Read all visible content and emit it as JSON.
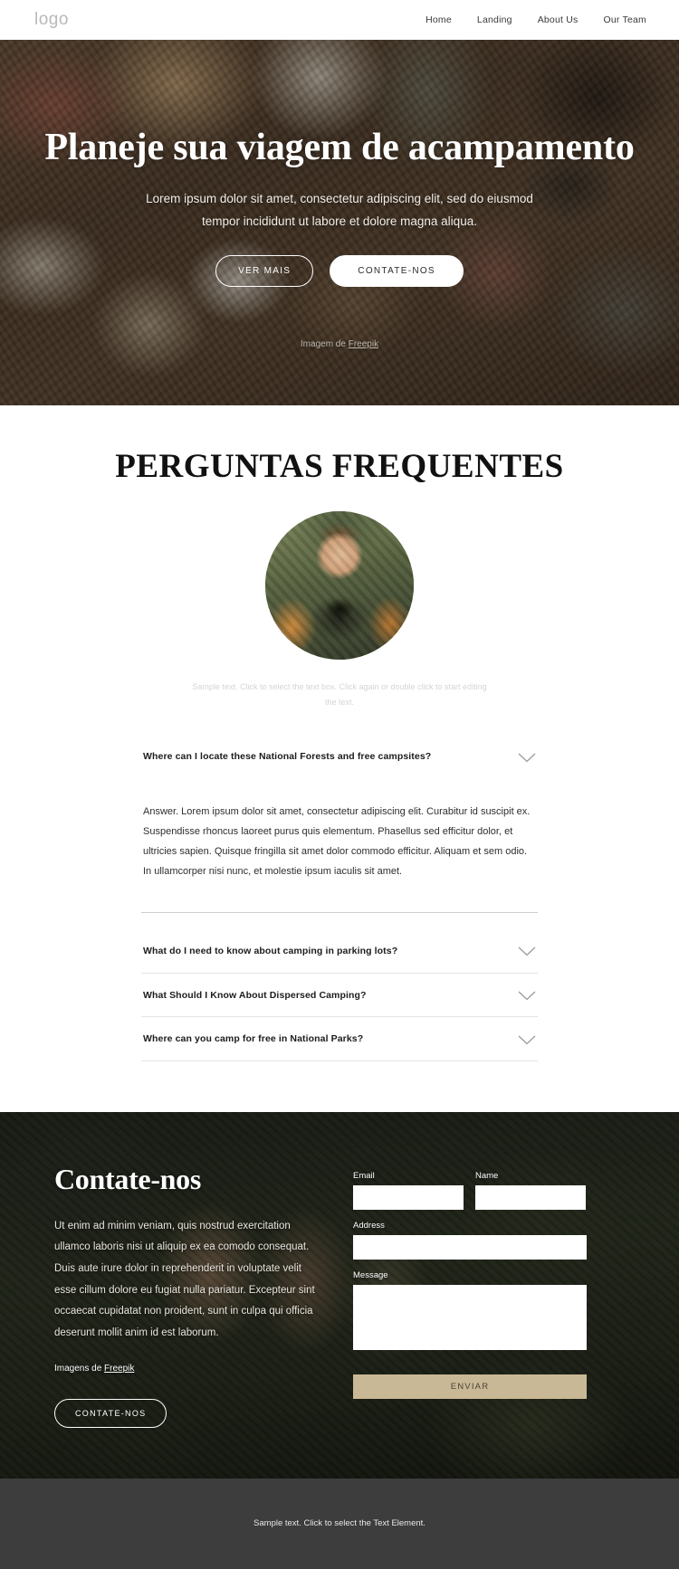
{
  "header": {
    "logo": "logo",
    "nav": [
      {
        "label": "Home"
      },
      {
        "label": "Landing"
      },
      {
        "label": "About Us"
      },
      {
        "label": "Our Team"
      }
    ]
  },
  "hero": {
    "title": "Planeje sua viagem de acampamento",
    "subtitle": "Lorem ipsum dolor sit amet, consectetur adipiscing elit, sed do eiusmod tempor incididunt ut labore et dolore magna aliqua.",
    "primary_button": "VER MAIS",
    "secondary_button": "CONTATE-NOS",
    "credit_prefix": "Imagem de ",
    "credit_link": "Freepik"
  },
  "faq": {
    "title": "PERGUNTAS FREQUENTES",
    "note": "Sample text. Click to select the text box. Click again or double click to start editing the text.",
    "items": [
      {
        "question": "Where can I locate these National Forests and free campsites?",
        "answer": "Answer. Lorem ipsum dolor sit amet, consectetur adipiscing elit. Curabitur id suscipit ex. Suspendisse rhoncus laoreet purus quis elementum. Phasellus sed efficitur dolor, et ultricies sapien. Quisque fringilla sit amet dolor commodo efficitur. Aliquam et sem odio. In ullamcorper nisi nunc, et molestie ipsum iaculis sit amet.",
        "open": true
      },
      {
        "question": "What do I need to know about camping in parking lots?",
        "answer": "",
        "open": false
      },
      {
        "question": "What Should I Know About Dispersed Camping?",
        "answer": "",
        "open": false
      },
      {
        "question": "Where can you camp for free in National Parks?",
        "answer": "",
        "open": false
      }
    ]
  },
  "contact": {
    "title": "Contate-nos",
    "body": "Ut enim ad minim veniam, quis nostrud exercitation ullamco laboris nisi ut aliquip ex ea comodo consequat. Duis aute irure dolor in reprehenderit in voluptate velit esse cillum dolore eu fugiat nulla pariatur. Excepteur sint occaecat cupidatat non proident, sunt in culpa qui officia deserunt mollit anim id est laborum.",
    "credit_prefix": "Imagens de ",
    "credit_link": "Freepik",
    "button": "CONTATE-NOS",
    "form": {
      "email_label": "Email",
      "email_value": "",
      "name_label": "Name",
      "name_value": "",
      "address_label": "Address",
      "address_value": "",
      "message_label": "Message",
      "message_value": "",
      "submit_label": "ENVIAR"
    }
  },
  "footer": {
    "text": "Sample text. Click to select the Text Element."
  },
  "colors": {
    "accent_button": "#c9b895",
    "footer_bg": "#3d3d3d"
  }
}
